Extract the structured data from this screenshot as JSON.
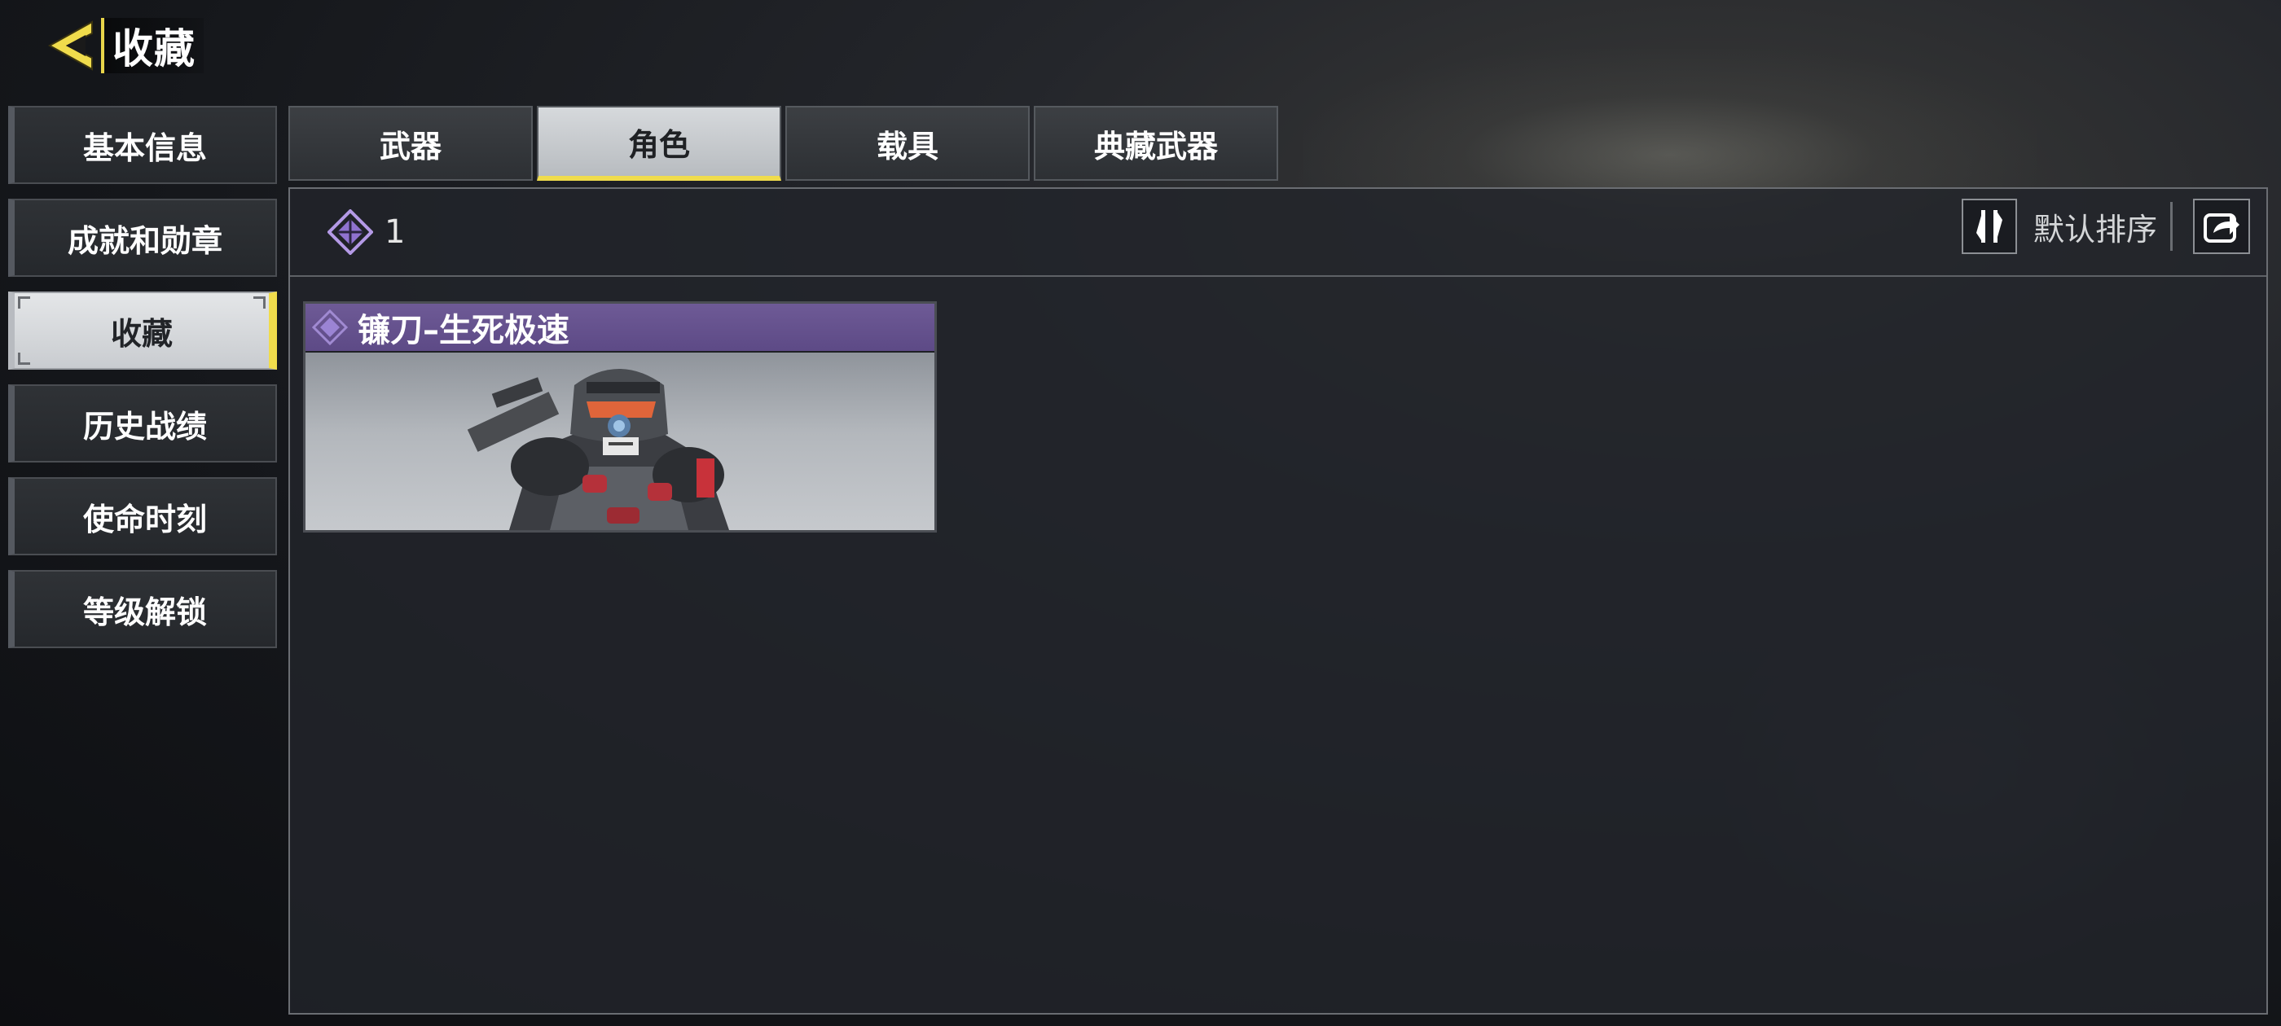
{
  "header": {
    "title": "收藏",
    "back_icon": "back-arrow-icon",
    "accent_color": "#f0dc4c"
  },
  "sidebar": {
    "items": [
      {
        "label": "基本信息",
        "active": false
      },
      {
        "label": "成就和勋章",
        "active": false
      },
      {
        "label": "收藏",
        "active": true
      },
      {
        "label": "历史战绩",
        "active": false
      },
      {
        "label": "使命时刻",
        "active": false
      },
      {
        "label": "等级解锁",
        "active": false
      }
    ]
  },
  "tabs": [
    {
      "label": "武器",
      "active": false
    },
    {
      "label": "角色",
      "active": true
    },
    {
      "label": "载具",
      "active": false
    },
    {
      "label": "典藏武器",
      "active": false
    }
  ],
  "toolbar": {
    "count": "1",
    "count_icon": "legendary-diamond-icon",
    "sort_icon": "sort-arrows-icon",
    "sort_label": "默认排序",
    "share_icon": "share-icon"
  },
  "items": [
    {
      "name": "镰刀–生死极速",
      "rarity_color": "#6e5a96",
      "rarity_icon": "legendary-diamond-icon"
    }
  ]
}
